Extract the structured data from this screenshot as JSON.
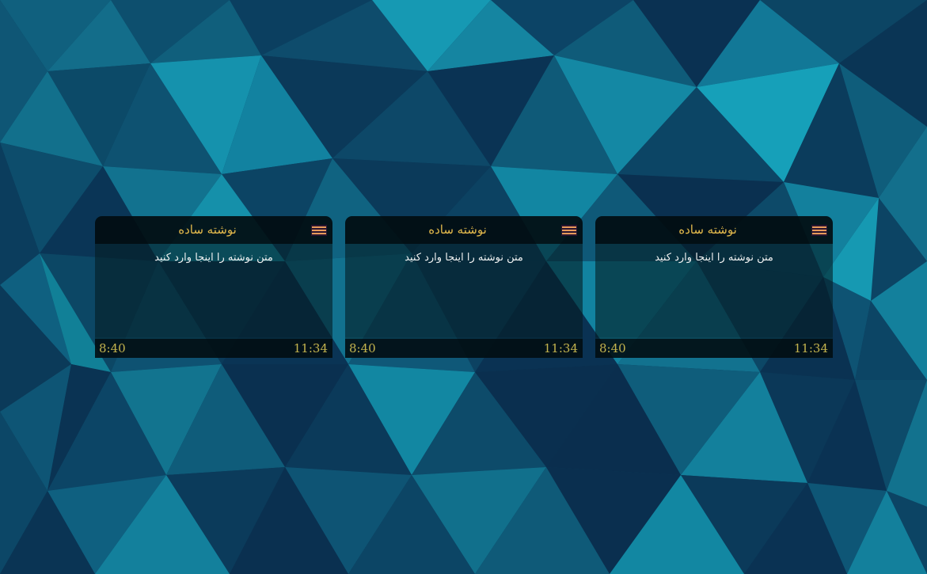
{
  "colors": {
    "title": "#e4ba4c",
    "time": "#c5b44e",
    "text": "#f0f2f2",
    "menu_icon": "#e79a5a"
  },
  "notes": [
    {
      "title": "نوشته ساده",
      "body": "متن نوشته را اینجا وارد کنید",
      "time_left": "8:40",
      "time_right": "11:34",
      "menu_icon": "menu-icon"
    },
    {
      "title": "نوشته ساده",
      "body": "متن نوشته را اینجا وارد کنید",
      "time_left": "8:40",
      "time_right": "11:34",
      "menu_icon": "menu-icon"
    },
    {
      "title": "نوشته ساده",
      "body": "متن نوشته را اینجا وارد کنید",
      "time_left": "8:40",
      "time_right": "11:34",
      "menu_icon": "menu-icon"
    }
  ]
}
